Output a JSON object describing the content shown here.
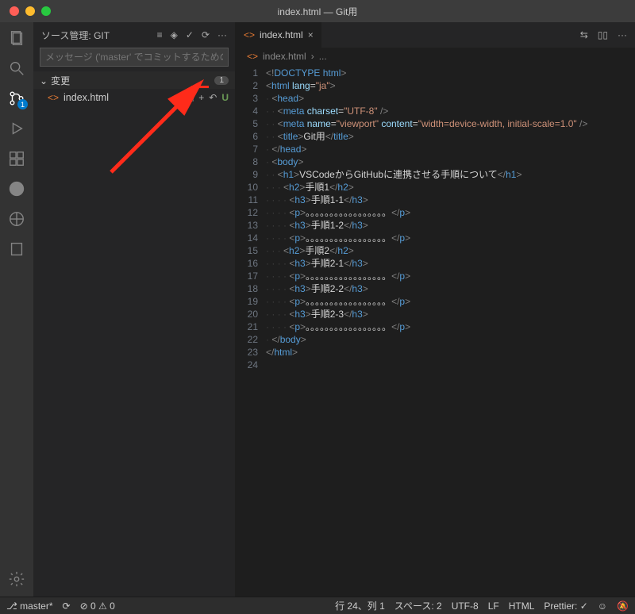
{
  "window": {
    "title": "index.html — Git用"
  },
  "activitybar": {
    "scm_badge": "1"
  },
  "sidebar": {
    "title": "ソース管理: GIT",
    "commit_placeholder": "メッセージ ('master' でコミットするための ⌘Enter)",
    "section_changes": "変更",
    "changes_count": "1",
    "file": {
      "name": "index.html",
      "status": "U"
    }
  },
  "tabs": {
    "file": "index.html"
  },
  "tab_actions": {
    "scm": "⇆",
    "split": "▯▯",
    "more": "···"
  },
  "breadcrumbs": {
    "file": "index.html",
    "sep": "›",
    "rest": "..."
  },
  "code": {
    "lines": [
      {
        "n": "1",
        "html": "<span class='br'>&lt;!</span><span class='doctype'>DOCTYPE</span> <span class='t'>html</span><span class='br'>&gt;</span>"
      },
      {
        "n": "2",
        "html": "<span class='br'>&lt;</span><span class='t'>html</span> <span class='a'>lang</span>=<span class='s'>\"ja\"</span><span class='br'>&gt;</span>"
      },
      {
        "n": "3",
        "html": "  <span class='br'>&lt;</span><span class='t'>head</span><span class='br'>&gt;</span>"
      },
      {
        "n": "4",
        "html": "    <span class='br'>&lt;</span><span class='t'>meta</span> <span class='a'>charset</span>=<span class='s'>\"UTF-8\"</span> <span class='br'>/&gt;</span>"
      },
      {
        "n": "5",
        "html": "    <span class='br'>&lt;</span><span class='t'>meta</span> <span class='a'>name</span>=<span class='s'>\"viewport\"</span> <span class='a'>content</span>=<span class='s'>\"width=device-width, initial-scale=1.0\"</span> <span class='br'>/&gt;</span>"
      },
      {
        "n": "6",
        "html": "    <span class='br'>&lt;</span><span class='t'>title</span><span class='br'>&gt;</span><span class='tx'>Git用</span><span class='br'>&lt;/</span><span class='t'>title</span><span class='br'>&gt;</span>"
      },
      {
        "n": "7",
        "html": "  <span class='br'>&lt;/</span><span class='t'>head</span><span class='br'>&gt;</span>"
      },
      {
        "n": "8",
        "html": "  <span class='br'>&lt;</span><span class='t'>body</span><span class='br'>&gt;</span>"
      },
      {
        "n": "9",
        "html": "    <span class='br'>&lt;</span><span class='t'>h1</span><span class='br'>&gt;</span><span class='tx'>VSCodeからGitHubに連携させる手順について</span><span class='br'>&lt;/</span><span class='t'>h1</span><span class='br'>&gt;</span>"
      },
      {
        "n": "10",
        "html": "      <span class='br'>&lt;</span><span class='t'>h2</span><span class='br'>&gt;</span><span class='tx'>手順1</span><span class='br'>&lt;/</span><span class='t'>h2</span><span class='br'>&gt;</span>"
      },
      {
        "n": "11",
        "html": "        <span class='br'>&lt;</span><span class='t'>h3</span><span class='br'>&gt;</span><span class='tx'>手順1-1</span><span class='br'>&lt;/</span><span class='t'>h3</span><span class='br'>&gt;</span>"
      },
      {
        "n": "12",
        "html": "        <span class='br'>&lt;</span><span class='t'>p</span><span class='br'>&gt;</span><span class='tx'>。。。。。。。。。。。。。。。。。</span><span class='br'>&lt;/</span><span class='t'>p</span><span class='br'>&gt;</span>"
      },
      {
        "n": "13",
        "html": "        <span class='br'>&lt;</span><span class='t'>h3</span><span class='br'>&gt;</span><span class='tx'>手順1-2</span><span class='br'>&lt;/</span><span class='t'>h3</span><span class='br'>&gt;</span>"
      },
      {
        "n": "14",
        "html": "        <span class='br'>&lt;</span><span class='t'>p</span><span class='br'>&gt;</span><span class='tx'>。。。。。。。。。。。。。。。。。</span><span class='br'>&lt;/</span><span class='t'>p</span><span class='br'>&gt;</span>"
      },
      {
        "n": "15",
        "html": "      <span class='br'>&lt;</span><span class='t'>h2</span><span class='br'>&gt;</span><span class='tx'>手順2</span><span class='br'>&lt;/</span><span class='t'>h2</span><span class='br'>&gt;</span>"
      },
      {
        "n": "16",
        "html": "        <span class='br'>&lt;</span><span class='t'>h3</span><span class='br'>&gt;</span><span class='tx'>手順2-1</span><span class='br'>&lt;/</span><span class='t'>h3</span><span class='br'>&gt;</span>"
      },
      {
        "n": "17",
        "html": "        <span class='br'>&lt;</span><span class='t'>p</span><span class='br'>&gt;</span><span class='tx'>。。。。。。。。。。。。。。。。。</span><span class='br'>&lt;/</span><span class='t'>p</span><span class='br'>&gt;</span>"
      },
      {
        "n": "18",
        "html": "        <span class='br'>&lt;</span><span class='t'>h3</span><span class='br'>&gt;</span><span class='tx'>手順2-2</span><span class='br'>&lt;/</span><span class='t'>h3</span><span class='br'>&gt;</span>"
      },
      {
        "n": "19",
        "html": "        <span class='br'>&lt;</span><span class='t'>p</span><span class='br'>&gt;</span><span class='tx'>。。。。。。。。。。。。。。。。。</span><span class='br'>&lt;/</span><span class='t'>p</span><span class='br'>&gt;</span>"
      },
      {
        "n": "20",
        "html": "        <span class='br'>&lt;</span><span class='t'>h3</span><span class='br'>&gt;</span><span class='tx'>手順2-3</span><span class='br'>&lt;/</span><span class='t'>h3</span><span class='br'>&gt;</span>"
      },
      {
        "n": "21",
        "html": "        <span class='br'>&lt;</span><span class='t'>p</span><span class='br'>&gt;</span><span class='tx'>。。。。。。。。。。。。。。。。。</span><span class='br'>&lt;/</span><span class='t'>p</span><span class='br'>&gt;</span>"
      },
      {
        "n": "22",
        "html": "  <span class='br'>&lt;/</span><span class='t'>body</span><span class='br'>&gt;</span>"
      },
      {
        "n": "23",
        "html": "<span class='br'>&lt;/</span><span class='t'>html</span><span class='br'>&gt;</span>"
      },
      {
        "n": "24",
        "html": ""
      }
    ]
  },
  "status": {
    "branch": "master*",
    "sync": "⟳",
    "problems": "⊘ 0 ⚠ 0",
    "linecol": "行 24、列 1",
    "spaces": "スペース: 2",
    "encoding": "UTF-8",
    "eol": "LF",
    "lang": "HTML",
    "prettier": "Prettier: ✓",
    "feedback": "☺",
    "bell": "🔕"
  }
}
